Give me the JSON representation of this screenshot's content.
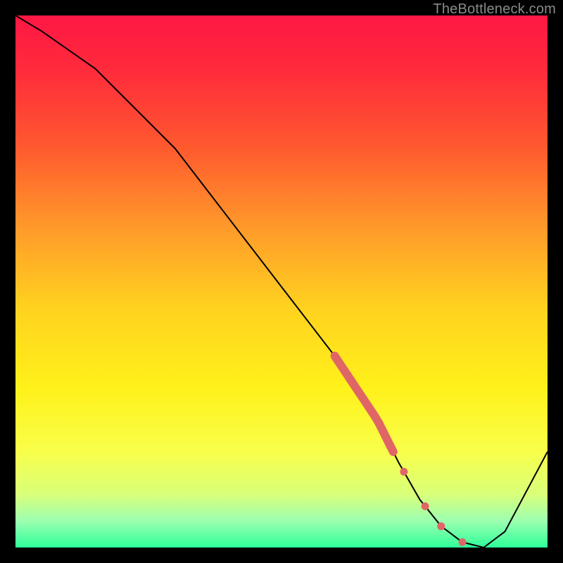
{
  "attribution": "TheBottleneck.com",
  "colors": {
    "frame": "#000000",
    "curve": "#000000",
    "marker": "#e06666",
    "gradient_stops": [
      {
        "offset": 0.0,
        "color": "#ff1744"
      },
      {
        "offset": 0.1,
        "color": "#ff2a3c"
      },
      {
        "offset": 0.25,
        "color": "#ff5a2e"
      },
      {
        "offset": 0.4,
        "color": "#ff9a2a"
      },
      {
        "offset": 0.55,
        "color": "#ffd21f"
      },
      {
        "offset": 0.7,
        "color": "#fff11a"
      },
      {
        "offset": 0.82,
        "color": "#f8ff4a"
      },
      {
        "offset": 0.9,
        "color": "#d9ff7a"
      },
      {
        "offset": 0.95,
        "color": "#9cffb0"
      },
      {
        "offset": 1.0,
        "color": "#2eff9a"
      }
    ]
  },
  "chart_data": {
    "type": "line",
    "title": "",
    "xlabel": "",
    "ylabel": "",
    "xlim": [
      0,
      100
    ],
    "ylim": [
      0,
      100
    ],
    "x": [
      0,
      5,
      15,
      23,
      30,
      40,
      50,
      60,
      68,
      72,
      76,
      80,
      84,
      88,
      92,
      100
    ],
    "values": [
      100,
      97,
      90,
      82,
      75,
      62,
      49,
      36,
      24,
      16,
      9,
      4,
      1,
      0,
      3,
      18
    ],
    "highlight_segment": {
      "x_start": 60,
      "x_end": 71
    },
    "flat_dots_x": [
      73,
      77,
      80,
      84
    ]
  }
}
